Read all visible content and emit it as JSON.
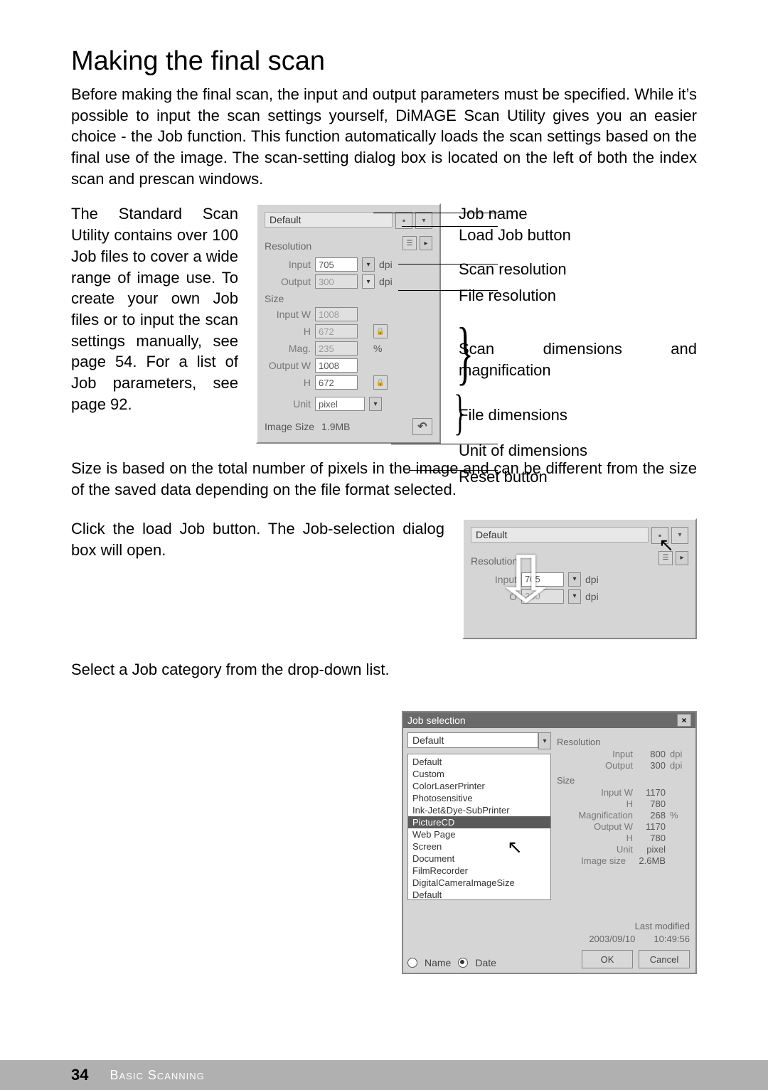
{
  "title": "Making the final scan",
  "intro": "Before making the final scan, the input and output parameters must be specified. While it’s possible to input the scan settings yourself, DiMAGE Scan Utility gives you an easier choice - the Job function. This function automatically loads the scan settings based on the final use of the image. The scan-setting dialog box is located on the left of both the index scan and prescan windows.",
  "leftcol": "The Standard Scan Utility contains over 100 Job files to cover a wide range of image use. To create your own Job files or to input the scan settings manually, see page 54. For a list of Job parameters, see page 92.",
  "panel": {
    "job_name": "Default",
    "group_resolution": "Resolution",
    "input_label": "Input",
    "input_value": "705",
    "output_label": "Output",
    "output_value": "300",
    "dpi": "dpi",
    "group_size": "Size",
    "input_w_label": "Input W",
    "input_w_value": "1008",
    "h_label": "H",
    "input_h_value": "672",
    "mag_label": "Mag.",
    "mag_value": "235",
    "pct": "%",
    "output_w_label": "Output W",
    "output_w_value": "1008",
    "output_h_value": "672",
    "unit_label": "Unit",
    "unit_value": "pixel",
    "image_size_label": "Image Size",
    "image_size_value": "1.9MB"
  },
  "callouts": {
    "job_name": "Job name",
    "load_job": "Load Job button",
    "scan_res": "Scan resolution",
    "file_res": "File resolution",
    "scan_dim": "Scan dimensions and magnification",
    "file_dim": "File dimensions",
    "unit": "Unit of dimensions",
    "reset": "Reset button"
  },
  "sizenote": "Size is based on the total number of pixels in the image and can be different from the size of the saved data depending on the file format selected.",
  "step1": "Click the load Job button. The Job-selection dialog box will open.",
  "step2": "Select a Job category from the drop-down list.",
  "mini": {
    "job_name": "Default",
    "res_label": "Resolution",
    "input_label": "Input",
    "input_value": "705",
    "dpi": "dpi",
    "output_value": "300"
  },
  "jobsel": {
    "title": "Job selection",
    "selected": "Default",
    "categories": [
      "Default",
      "Custom",
      "ColorLaserPrinter",
      "Photosensitive",
      "Ink-Jet&Dye-SubPrinter",
      "PictureCD",
      "Web Page",
      "Screen",
      "Document",
      "FilmRecorder",
      "DigitalCameraImageSize",
      "Default"
    ],
    "selected_index": 5,
    "res_title": "Resolution",
    "input": "Input",
    "input_v": "800",
    "output": "Output",
    "output_v": "300",
    "dpi": "dpi",
    "size_title": "Size",
    "iw": "Input W",
    "iw_v": "1170",
    "h": "H",
    "h_v": "780",
    "mag": "Magnification",
    "mag_v": "268",
    "pct": "%",
    "ow": "Output W",
    "ow_v": "1170",
    "oh_v": "780",
    "unit": "Unit",
    "unit_v": "pixel",
    "isize": "Image size",
    "isize_v": "2.6MB",
    "lastmod_label": "Last modified",
    "lastmod": "2003/09/10  10:49:56",
    "sort_name": "Name",
    "sort_date": "Date",
    "ok": "OK",
    "cancel": "Cancel"
  },
  "footer": {
    "page": "34",
    "chapter": "Basic Scanning"
  }
}
